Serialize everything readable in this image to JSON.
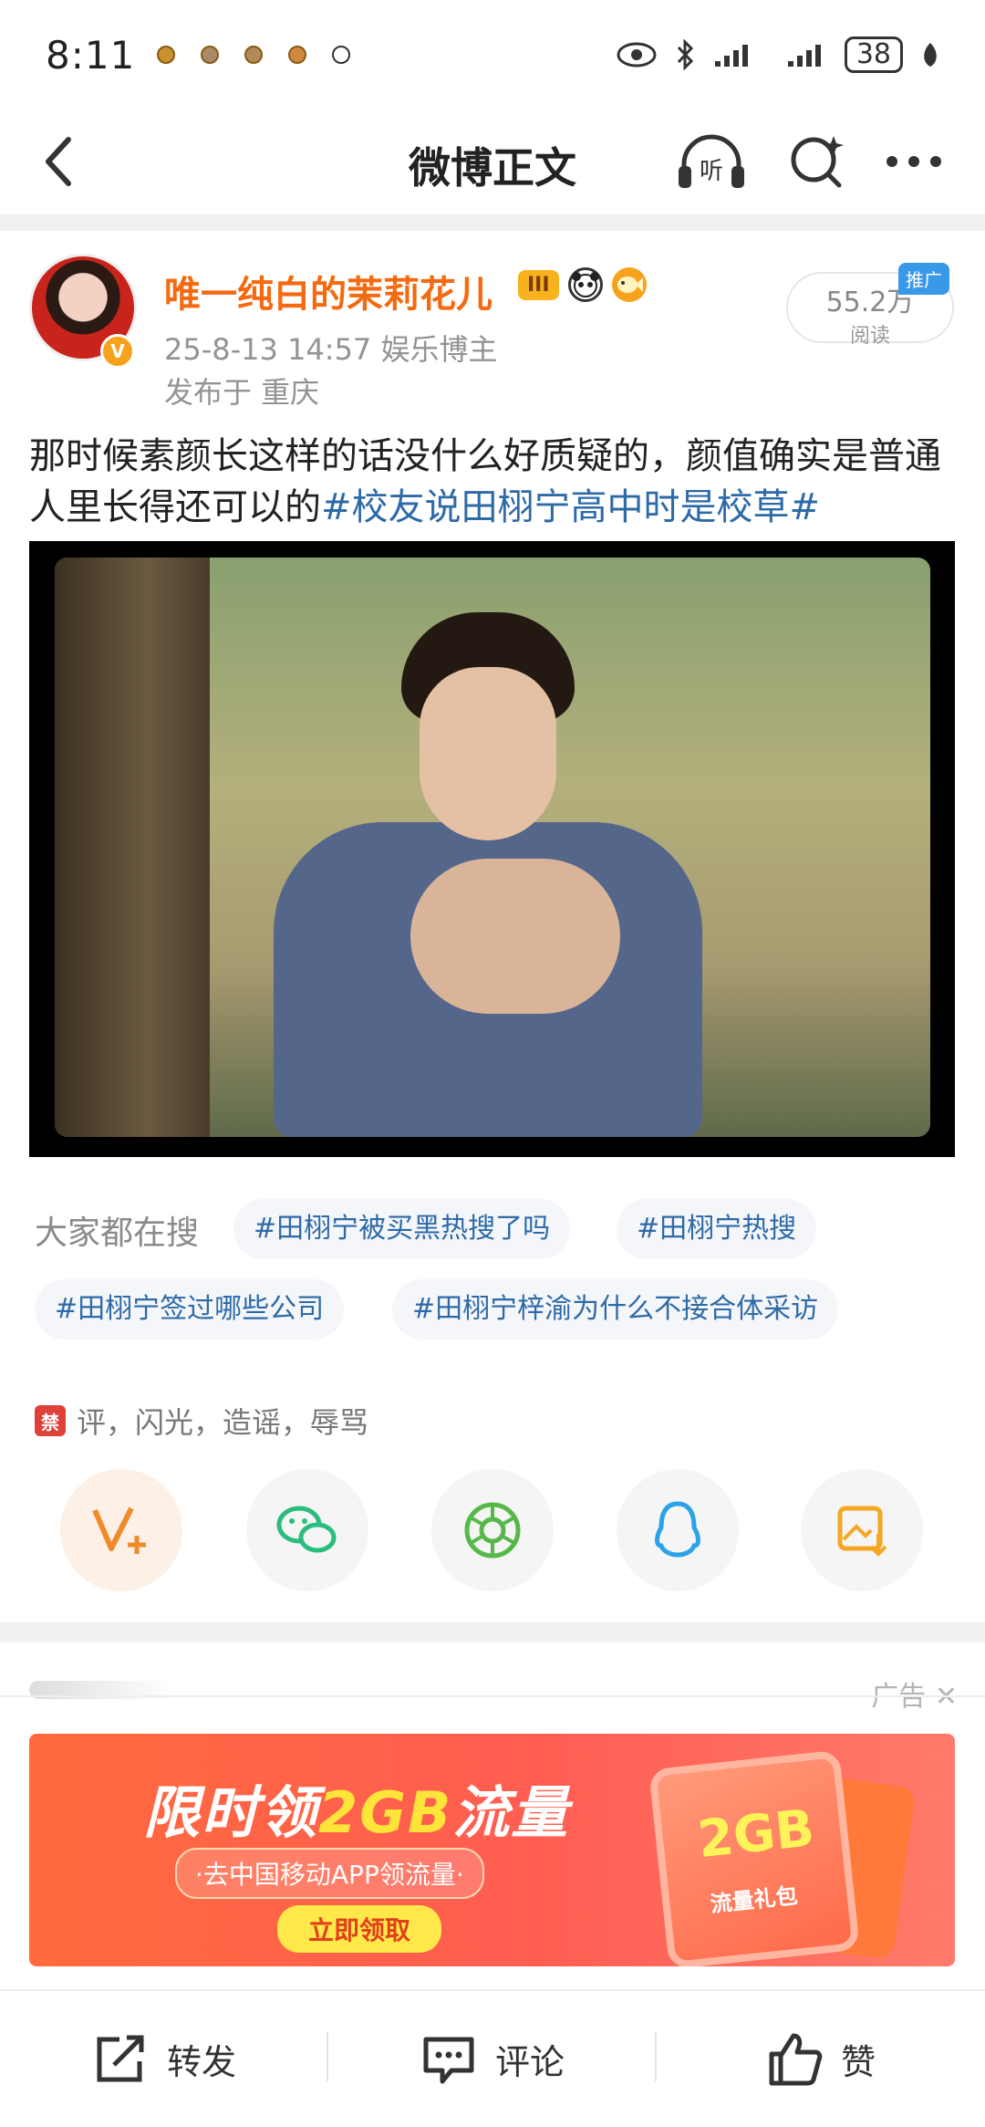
{
  "status_bar": {
    "time": "8:11",
    "battery": "38"
  },
  "header": {
    "title": "微博正文",
    "listen_label": "听"
  },
  "post": {
    "username": "唯一纯白的茉莉花儿",
    "level_badge": "III",
    "meta": "25-8-13 14:57   娱乐博主",
    "location": "发布于 重庆",
    "read_count": "55.2万",
    "read_label": "阅读",
    "promo_badge": "推广",
    "text_prefix": "那时候素颜长这样的话没什么好质疑的，颜值确实是普通人里长得还可以的",
    "topic": "#校友说田栩宁高中时是校草#"
  },
  "search": {
    "label": "大家都在搜",
    "chips": [
      "#田栩宁被买黑热搜了吗",
      "#田栩宁热搜",
      "#田栩宁签过哪些公司",
      "#田栩宁梓渝为什么不接合体采访"
    ]
  },
  "ban_notice": {
    "icon_text": "禁",
    "text": "评，闪光，造谣，辱骂"
  },
  "share_icons": [
    "vplus-icon",
    "wechat-icon",
    "moments-icon",
    "qq-icon",
    "save-image-icon"
  ],
  "ad": {
    "label": "广告",
    "banner_title_1": "限时领",
    "banner_title_2": "2GB",
    "banner_title_3": "流量",
    "banner_sub": "·去中国移动APP领流量·",
    "banner_button": "立即领取",
    "gift_gb": "2GB",
    "gift_label": "流量礼包"
  },
  "bottom_bar": {
    "repost": "转发",
    "comment": "评论",
    "like": "赞"
  },
  "colors": {
    "username": "#f46a10",
    "topic": "#2d6aa8",
    "promo": "#3a98e8"
  }
}
